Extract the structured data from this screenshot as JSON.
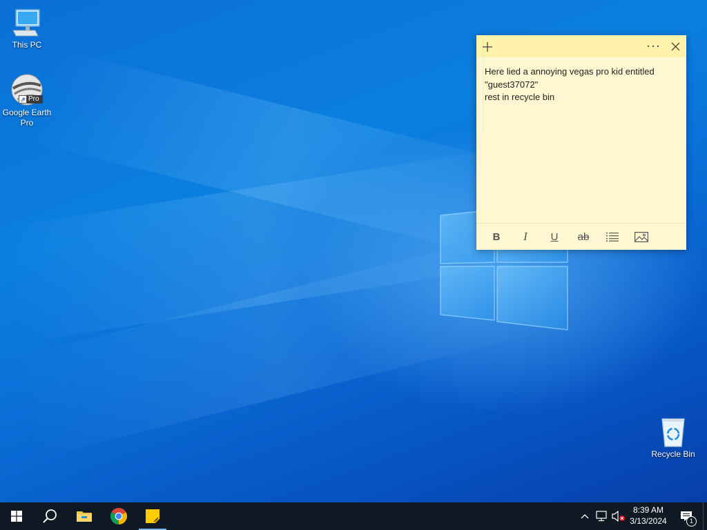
{
  "desktop": {
    "icons": [
      {
        "label": "This PC",
        "icon": "computer-icon"
      },
      {
        "label": "Google Earth Pro",
        "icon": "google-earth-icon",
        "badge": "Pro"
      },
      {
        "label": "Recycle Bin",
        "icon": "recycle-bin-icon"
      }
    ]
  },
  "sticky_note": {
    "text_lines": [
      "Here lied a annoying vegas pro kid entitled",
      "\"guest37072\"",
      "rest in recycle bin"
    ],
    "titlebar": {
      "add_icon": "plus-icon",
      "menu_icon": "more-icon",
      "close_icon": "close-icon"
    },
    "format_bar": {
      "bold": "B",
      "italic": "I",
      "underline": "U",
      "strikethrough": "ab",
      "list_icon": "bullet-list-icon",
      "image_icon": "image-icon"
    },
    "colors": {
      "body": "#fff7d1",
      "titlebar": "#fff2ab"
    }
  },
  "taskbar": {
    "pinned": [
      {
        "name": "start",
        "icon": "windows-start-icon"
      },
      {
        "name": "search",
        "icon": "search-icon"
      },
      {
        "name": "file-explorer",
        "icon": "folder-icon"
      },
      {
        "name": "chrome",
        "icon": "chrome-icon"
      },
      {
        "name": "sticky-notes",
        "icon": "sticky-notes-icon"
      }
    ],
    "tray": {
      "time": "8:39 AM",
      "date": "3/13/2024",
      "notification_count": "1"
    },
    "colors": {
      "background": "#0f1923",
      "active_indicator": "#7ab8f0"
    }
  }
}
